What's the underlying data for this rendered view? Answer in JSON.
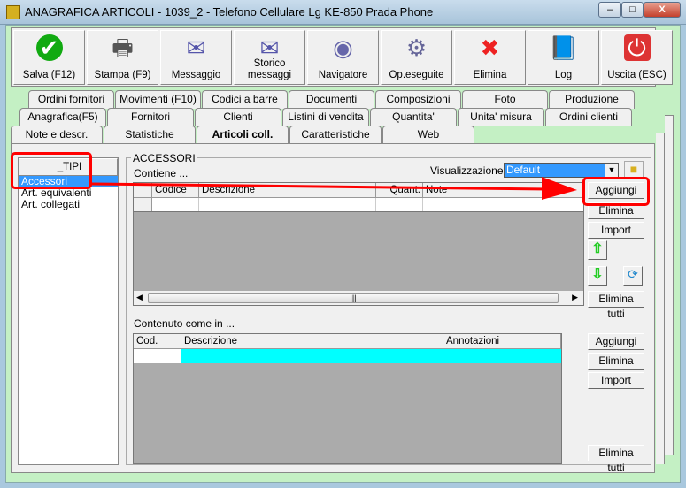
{
  "window": {
    "title": "ANAGRAFICA ARTICOLI - 1039_2 - Telefono Cellulare Lg KE-850 Prada Phone",
    "min": "–",
    "max": "□",
    "close": "X"
  },
  "toolbar": [
    {
      "label": "Salva (F12)",
      "icon": "check-icon"
    },
    {
      "label": "Stampa (F9)",
      "icon": "printer-icon"
    },
    {
      "label": "Messaggio",
      "icon": "envelope-pen-icon"
    },
    {
      "label": "Storico messaggi",
      "icon": "envelope-search-icon"
    },
    {
      "label": "Navigatore",
      "icon": "compass-icon"
    },
    {
      "label": "Op.eseguite",
      "icon": "gears-search-icon"
    },
    {
      "label": "Elimina",
      "icon": "red-x-icon"
    },
    {
      "label": "Log",
      "icon": "book-search-icon"
    },
    {
      "label": "Uscita (ESC)",
      "icon": "power-icon"
    }
  ],
  "tabs_row1": [
    "Ordini fornitori",
    "Movimenti (F10)",
    "Codici a barre",
    "Documenti",
    "Composizioni",
    "Foto",
    "Produzione"
  ],
  "tabs_row2": [
    "Anagrafica(F5)",
    "Fornitori",
    "Clienti",
    "Listini di vendita",
    "Quantita'",
    "Unita' misura",
    "Ordini clienti"
  ],
  "tabs_row3": [
    "Note e descr.",
    "Statistiche",
    "Articoli coll.",
    "Caratteristiche",
    "Web"
  ],
  "types": {
    "header": "_TIPI",
    "items": [
      "Accessori",
      "Art. equivalenti",
      "Art. collegati"
    ],
    "selected": 0
  },
  "group": {
    "title": "ACCESSORI",
    "contains": "Contiene ...",
    "view_label": "Visualizzazione :",
    "view_value": "Default",
    "grid1_cols": [
      "Codice",
      "Descrizione",
      "Quant.",
      "Note"
    ],
    "contained_in": "Contenuto come  in ...",
    "grid2_cols": [
      "Cod.",
      "Descrizione",
      "Annotazioni"
    ]
  },
  "buttons1": {
    "add": "Aggiungi",
    "delete": "Elimina",
    "import": "Import",
    "delete_all": "Elimina tutti"
  },
  "buttons2": {
    "add": "Aggiungi",
    "delete": "Elimina",
    "import": "Import",
    "delete_all": "Elimina tutti"
  },
  "colors": {
    "selection": "#3399ff",
    "highlight_row": "#00ffff",
    "annotation": "#ff0000"
  }
}
